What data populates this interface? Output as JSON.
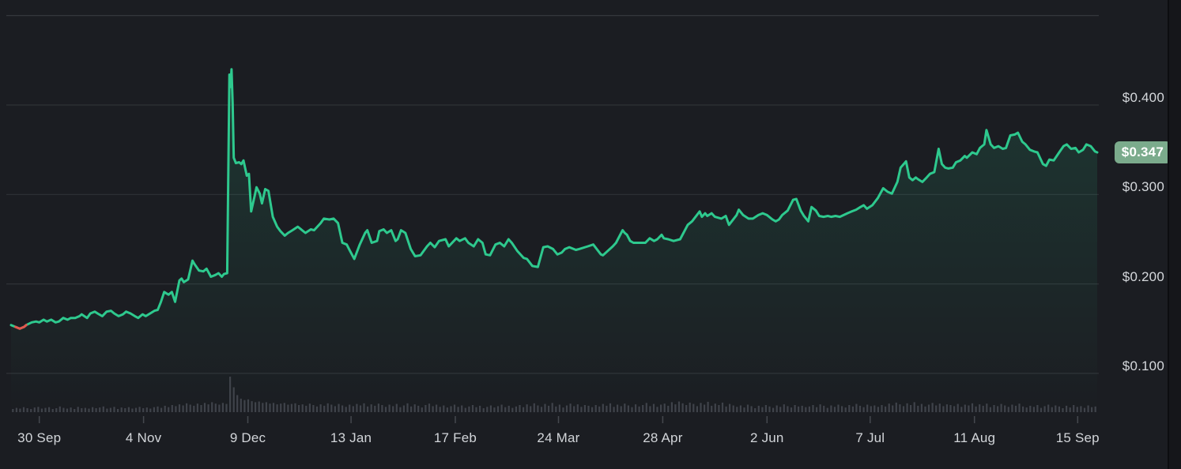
{
  "colors": {
    "background": "#1b1d22",
    "page_background": "#15161a",
    "grid": "#2f3237",
    "grid_top": "#383b40",
    "line_up": "#2ec98e",
    "line_down": "#e2574e",
    "area_tint": "#2ec98e",
    "volume_bar": "#3f434a",
    "tick": "#45484e",
    "label_text": "#d5d8dc",
    "badge_bg": "#7bab8c",
    "badge_text": "#ffffff"
  },
  "chart_data": {
    "type": "line",
    "title": "",
    "legend": "none",
    "grid": "on",
    "current_price": 0.347,
    "current_price_label": "$0.347",
    "y_ticks": [
      {
        "value": 0.4,
        "label": "$0.400"
      },
      {
        "value": 0.3,
        "label": "$0.300"
      },
      {
        "value": 0.2,
        "label": "$0.200"
      },
      {
        "value": 0.1,
        "label": "$0.100"
      }
    ],
    "y_grid_values": [
      0.5,
      0.4,
      0.3,
      0.2,
      0.1
    ],
    "ylim": [
      0.1,
      0.5
    ],
    "x_ticks": [
      {
        "t": 0.026,
        "label": "30 Sep"
      },
      {
        "t": 0.122,
        "label": "4 Nov"
      },
      {
        "t": 0.218,
        "label": "9 Dec"
      },
      {
        "t": 0.313,
        "label": "13 Jan"
      },
      {
        "t": 0.409,
        "label": "17 Feb"
      },
      {
        "t": 0.504,
        "label": "24 Mar"
      },
      {
        "t": 0.6,
        "label": "28 Apr"
      },
      {
        "t": 0.696,
        "label": "2 Jun"
      },
      {
        "t": 0.791,
        "label": "7 Jul"
      },
      {
        "t": 0.887,
        "label": "11 Aug"
      },
      {
        "t": 0.982,
        "label": "15 Sep"
      }
    ],
    "down_segment": {
      "t_start": 0.003,
      "t_end": 0.015
    },
    "price_points": [
      [
        0.0,
        0.154
      ],
      [
        0.004,
        0.152
      ],
      [
        0.008,
        0.15
      ],
      [
        0.012,
        0.152
      ],
      [
        0.014,
        0.154
      ],
      [
        0.019,
        0.157
      ],
      [
        0.023,
        0.158
      ],
      [
        0.026,
        0.157
      ],
      [
        0.03,
        0.16
      ],
      [
        0.033,
        0.158
      ],
      [
        0.037,
        0.16
      ],
      [
        0.041,
        0.157
      ],
      [
        0.044,
        0.158
      ],
      [
        0.048,
        0.162
      ],
      [
        0.052,
        0.16
      ],
      [
        0.055,
        0.162
      ],
      [
        0.059,
        0.162
      ],
      [
        0.063,
        0.164
      ],
      [
        0.065,
        0.166
      ],
      [
        0.07,
        0.162
      ],
      [
        0.073,
        0.167
      ],
      [
        0.077,
        0.169
      ],
      [
        0.081,
        0.166
      ],
      [
        0.084,
        0.164
      ],
      [
        0.088,
        0.169
      ],
      [
        0.092,
        0.17
      ],
      [
        0.095,
        0.167
      ],
      [
        0.099,
        0.164
      ],
      [
        0.103,
        0.166
      ],
      [
        0.106,
        0.169
      ],
      [
        0.11,
        0.167
      ],
      [
        0.114,
        0.164
      ],
      [
        0.117,
        0.162
      ],
      [
        0.121,
        0.166
      ],
      [
        0.124,
        0.164
      ],
      [
        0.128,
        0.167
      ],
      [
        0.132,
        0.17
      ],
      [
        0.135,
        0.171
      ],
      [
        0.138,
        0.18
      ],
      [
        0.141,
        0.191
      ],
      [
        0.145,
        0.188
      ],
      [
        0.148,
        0.191
      ],
      [
        0.151,
        0.18
      ],
      [
        0.155,
        0.204
      ],
      [
        0.157,
        0.206
      ],
      [
        0.159,
        0.202
      ],
      [
        0.163,
        0.205
      ],
      [
        0.167,
        0.226
      ],
      [
        0.169,
        0.222
      ],
      [
        0.173,
        0.215
      ],
      [
        0.177,
        0.214
      ],
      [
        0.18,
        0.217
      ],
      [
        0.184,
        0.208
      ],
      [
        0.188,
        0.21
      ],
      [
        0.191,
        0.212
      ],
      [
        0.194,
        0.208
      ],
      [
        0.196,
        0.211
      ],
      [
        0.199,
        0.212
      ],
      [
        0.201,
        0.434
      ],
      [
        0.202,
        0.42
      ],
      [
        0.203,
        0.44
      ],
      [
        0.204,
        0.402
      ],
      [
        0.205,
        0.341
      ],
      [
        0.207,
        0.335
      ],
      [
        0.21,
        0.336
      ],
      [
        0.212,
        0.334
      ],
      [
        0.214,
        0.338
      ],
      [
        0.217,
        0.321
      ],
      [
        0.219,
        0.323
      ],
      [
        0.221,
        0.281
      ],
      [
        0.224,
        0.297
      ],
      [
        0.226,
        0.308
      ],
      [
        0.229,
        0.301
      ],
      [
        0.231,
        0.29
      ],
      [
        0.234,
        0.306
      ],
      [
        0.237,
        0.304
      ],
      [
        0.241,
        0.275
      ],
      [
        0.245,
        0.264
      ],
      [
        0.248,
        0.259
      ],
      [
        0.252,
        0.254
      ],
      [
        0.255,
        0.257
      ],
      [
        0.259,
        0.26
      ],
      [
        0.264,
        0.264
      ],
      [
        0.268,
        0.26
      ],
      [
        0.271,
        0.257
      ],
      [
        0.276,
        0.261
      ],
      [
        0.279,
        0.26
      ],
      [
        0.285,
        0.268
      ],
      [
        0.288,
        0.273
      ],
      [
        0.293,
        0.272
      ],
      [
        0.297,
        0.273
      ],
      [
        0.301,
        0.268
      ],
      [
        0.305,
        0.246
      ],
      [
        0.309,
        0.244
      ],
      [
        0.312,
        0.237
      ],
      [
        0.316,
        0.228
      ],
      [
        0.321,
        0.244
      ],
      [
        0.326,
        0.257
      ],
      [
        0.328,
        0.26
      ],
      [
        0.332,
        0.246
      ],
      [
        0.337,
        0.248
      ],
      [
        0.339,
        0.259
      ],
      [
        0.343,
        0.261
      ],
      [
        0.346,
        0.257
      ],
      [
        0.35,
        0.26
      ],
      [
        0.354,
        0.248
      ],
      [
        0.356,
        0.25
      ],
      [
        0.359,
        0.26
      ],
      [
        0.363,
        0.257
      ],
      [
        0.368,
        0.239
      ],
      [
        0.372,
        0.231
      ],
      [
        0.377,
        0.232
      ],
      [
        0.383,
        0.242
      ],
      [
        0.386,
        0.246
      ],
      [
        0.39,
        0.241
      ],
      [
        0.394,
        0.248
      ],
      [
        0.4,
        0.25
      ],
      [
        0.403,
        0.242
      ],
      [
        0.41,
        0.251
      ],
      [
        0.413,
        0.248
      ],
      [
        0.418,
        0.251
      ],
      [
        0.421,
        0.246
      ],
      [
        0.426,
        0.242
      ],
      [
        0.43,
        0.25
      ],
      [
        0.434,
        0.246
      ],
      [
        0.437,
        0.233
      ],
      [
        0.441,
        0.232
      ],
      [
        0.446,
        0.244
      ],
      [
        0.45,
        0.246
      ],
      [
        0.454,
        0.242
      ],
      [
        0.458,
        0.25
      ],
      [
        0.461,
        0.246
      ],
      [
        0.466,
        0.237
      ],
      [
        0.472,
        0.229
      ],
      [
        0.475,
        0.228
      ],
      [
        0.48,
        0.22
      ],
      [
        0.485,
        0.219
      ],
      [
        0.49,
        0.241
      ],
      [
        0.494,
        0.242
      ],
      [
        0.499,
        0.239
      ],
      [
        0.503,
        0.233
      ],
      [
        0.507,
        0.235
      ],
      [
        0.51,
        0.239
      ],
      [
        0.514,
        0.241
      ],
      [
        0.52,
        0.238
      ],
      [
        0.523,
        0.239
      ],
      [
        0.531,
        0.242
      ],
      [
        0.536,
        0.244
      ],
      [
        0.543,
        0.233
      ],
      [
        0.545,
        0.232
      ],
      [
        0.554,
        0.242
      ],
      [
        0.557,
        0.246
      ],
      [
        0.563,
        0.26
      ],
      [
        0.565,
        0.257
      ],
      [
        0.567,
        0.255
      ],
      [
        0.57,
        0.248
      ],
      [
        0.573,
        0.246
      ],
      [
        0.577,
        0.246
      ],
      [
        0.584,
        0.246
      ],
      [
        0.588,
        0.251
      ],
      [
        0.592,
        0.248
      ],
      [
        0.595,
        0.25
      ],
      [
        0.599,
        0.255
      ],
      [
        0.601,
        0.251
      ],
      [
        0.605,
        0.25
      ],
      [
        0.61,
        0.248
      ],
      [
        0.616,
        0.25
      ],
      [
        0.623,
        0.266
      ],
      [
        0.627,
        0.27
      ],
      [
        0.634,
        0.281
      ],
      [
        0.636,
        0.275
      ],
      [
        0.639,
        0.279
      ],
      [
        0.641,
        0.276
      ],
      [
        0.645,
        0.279
      ],
      [
        0.648,
        0.275
      ],
      [
        0.654,
        0.273
      ],
      [
        0.658,
        0.276
      ],
      [
        0.661,
        0.266
      ],
      [
        0.668,
        0.277
      ],
      [
        0.67,
        0.283
      ],
      [
        0.674,
        0.277
      ],
      [
        0.679,
        0.273
      ],
      [
        0.683,
        0.273
      ],
      [
        0.688,
        0.277
      ],
      [
        0.692,
        0.279
      ],
      [
        0.696,
        0.277
      ],
      [
        0.701,
        0.272
      ],
      [
        0.704,
        0.27
      ],
      [
        0.707,
        0.272
      ],
      [
        0.71,
        0.277
      ],
      [
        0.715,
        0.282
      ],
      [
        0.72,
        0.294
      ],
      [
        0.723,
        0.295
      ],
      [
        0.727,
        0.282
      ],
      [
        0.73,
        0.276
      ],
      [
        0.734,
        0.27
      ],
      [
        0.737,
        0.286
      ],
      [
        0.741,
        0.282
      ],
      [
        0.744,
        0.276
      ],
      [
        0.748,
        0.275
      ],
      [
        0.752,
        0.276
      ],
      [
        0.755,
        0.275
      ],
      [
        0.759,
        0.276
      ],
      [
        0.763,
        0.275
      ],
      [
        0.77,
        0.279
      ],
      [
        0.774,
        0.281
      ],
      [
        0.778,
        0.283
      ],
      [
        0.782,
        0.286
      ],
      [
        0.785,
        0.288
      ],
      [
        0.788,
        0.284
      ],
      [
        0.793,
        0.288
      ],
      [
        0.798,
        0.296
      ],
      [
        0.803,
        0.307
      ],
      [
        0.807,
        0.303
      ],
      [
        0.811,
        0.301
      ],
      [
        0.816,
        0.314
      ],
      [
        0.819,
        0.33
      ],
      [
        0.824,
        0.337
      ],
      [
        0.827,
        0.319
      ],
      [
        0.83,
        0.316
      ],
      [
        0.833,
        0.319
      ],
      [
        0.835,
        0.317
      ],
      [
        0.839,
        0.314
      ],
      [
        0.843,
        0.319
      ],
      [
        0.846,
        0.323
      ],
      [
        0.85,
        0.325
      ],
      [
        0.854,
        0.351
      ],
      [
        0.857,
        0.334
      ],
      [
        0.86,
        0.33
      ],
      [
        0.863,
        0.329
      ],
      [
        0.867,
        0.33
      ],
      [
        0.87,
        0.336
      ],
      [
        0.874,
        0.338
      ],
      [
        0.878,
        0.343
      ],
      [
        0.88,
        0.341
      ],
      [
        0.885,
        0.347
      ],
      [
        0.889,
        0.345
      ],
      [
        0.892,
        0.352
      ],
      [
        0.896,
        0.356
      ],
      [
        0.898,
        0.372
      ],
      [
        0.902,
        0.356
      ],
      [
        0.905,
        0.352
      ],
      [
        0.909,
        0.354
      ],
      [
        0.913,
        0.351
      ],
      [
        0.916,
        0.352
      ],
      [
        0.92,
        0.366
      ],
      [
        0.924,
        0.367
      ],
      [
        0.927,
        0.369
      ],
      [
        0.931,
        0.359
      ],
      [
        0.934,
        0.356
      ],
      [
        0.938,
        0.35
      ],
      [
        0.942,
        0.348
      ],
      [
        0.945,
        0.347
      ],
      [
        0.95,
        0.334
      ],
      [
        0.953,
        0.332
      ],
      [
        0.956,
        0.339
      ],
      [
        0.96,
        0.338
      ],
      [
        0.965,
        0.347
      ],
      [
        0.969,
        0.354
      ],
      [
        0.972,
        0.356
      ],
      [
        0.976,
        0.351
      ],
      [
        0.98,
        0.352
      ],
      [
        0.983,
        0.347
      ],
      [
        0.987,
        0.35
      ],
      [
        0.99,
        0.356
      ],
      [
        0.994,
        0.354
      ],
      [
        0.998,
        0.348
      ],
      [
        1.0,
        0.347
      ]
    ],
    "volume_relative": [
      9,
      12,
      10,
      14,
      11,
      9,
      13,
      15,
      10,
      12,
      14,
      9,
      11,
      16,
      12,
      10,
      13,
      9,
      15,
      11,
      12,
      10,
      14,
      11,
      13,
      16,
      10,
      12,
      15,
      9,
      13,
      11,
      14,
      10,
      12,
      15,
      11,
      13,
      10,
      14,
      16,
      12,
      18,
      14,
      20,
      17,
      22,
      19,
      25,
      21,
      18,
      24,
      20,
      26,
      22,
      28,
      24,
      21,
      26,
      23,
      100,
      70,
      48,
      38,
      34,
      36,
      31,
      28,
      30,
      26,
      28,
      24,
      26,
      22,
      24,
      26,
      21,
      23,
      25,
      20,
      22,
      18,
      24,
      20,
      16,
      22,
      18,
      25,
      21,
      17,
      23,
      19,
      15,
      21,
      17,
      23,
      19,
      25,
      16,
      22,
      18,
      24,
      20,
      15,
      21,
      17,
      23,
      14,
      19,
      25,
      16,
      22,
      18,
      13,
      20,
      24,
      17,
      21,
      15,
      19,
      13,
      17,
      21,
      15,
      19,
      12,
      16,
      20,
      14,
      18,
      11,
      15,
      19,
      13,
      17,
      21,
      14,
      18,
      12,
      16,
      20,
      14,
      22,
      17,
      25,
      19,
      15,
      23,
      18,
      26,
      16,
      21,
      13,
      19,
      24,
      17,
      22,
      15,
      20,
      18,
      14,
      20,
      16,
      23,
      18,
      25,
      15,
      21,
      17,
      24,
      19,
      14,
      22,
      16,
      20,
      26,
      17,
      23,
      15,
      21,
      24,
      18,
      28,
      22,
      30,
      25,
      20,
      27,
      23,
      17,
      26,
      21,
      29,
      18,
      24,
      20,
      27,
      16,
      23,
      19,
      15,
      19,
      13,
      21,
      17,
      11,
      18,
      14,
      20,
      16,
      12,
      19,
      15,
      22,
      17,
      13,
      20,
      16,
      18,
      14,
      16,
      20,
      14,
      22,
      18,
      12,
      19,
      15,
      21,
      17,
      13,
      20,
      16,
      23,
      18,
      14,
      21,
      17,
      19,
      15,
      20,
      16,
      24,
      19,
      27,
      22,
      17,
      25,
      20,
      28,
      18,
      23,
      16,
      21,
      26,
      19,
      24,
      17,
      22,
      20,
      17,
      23,
      15,
      21,
      19,
      25,
      16,
      22,
      18,
      24,
      14,
      20,
      17,
      23,
      19,
      15,
      21,
      18,
      24,
      16,
      13,
      18,
      15,
      20,
      12,
      17,
      21,
      14,
      19,
      16,
      11,
      18,
      13,
      20,
      15,
      17,
      12,
      19,
      14,
      16
    ]
  }
}
